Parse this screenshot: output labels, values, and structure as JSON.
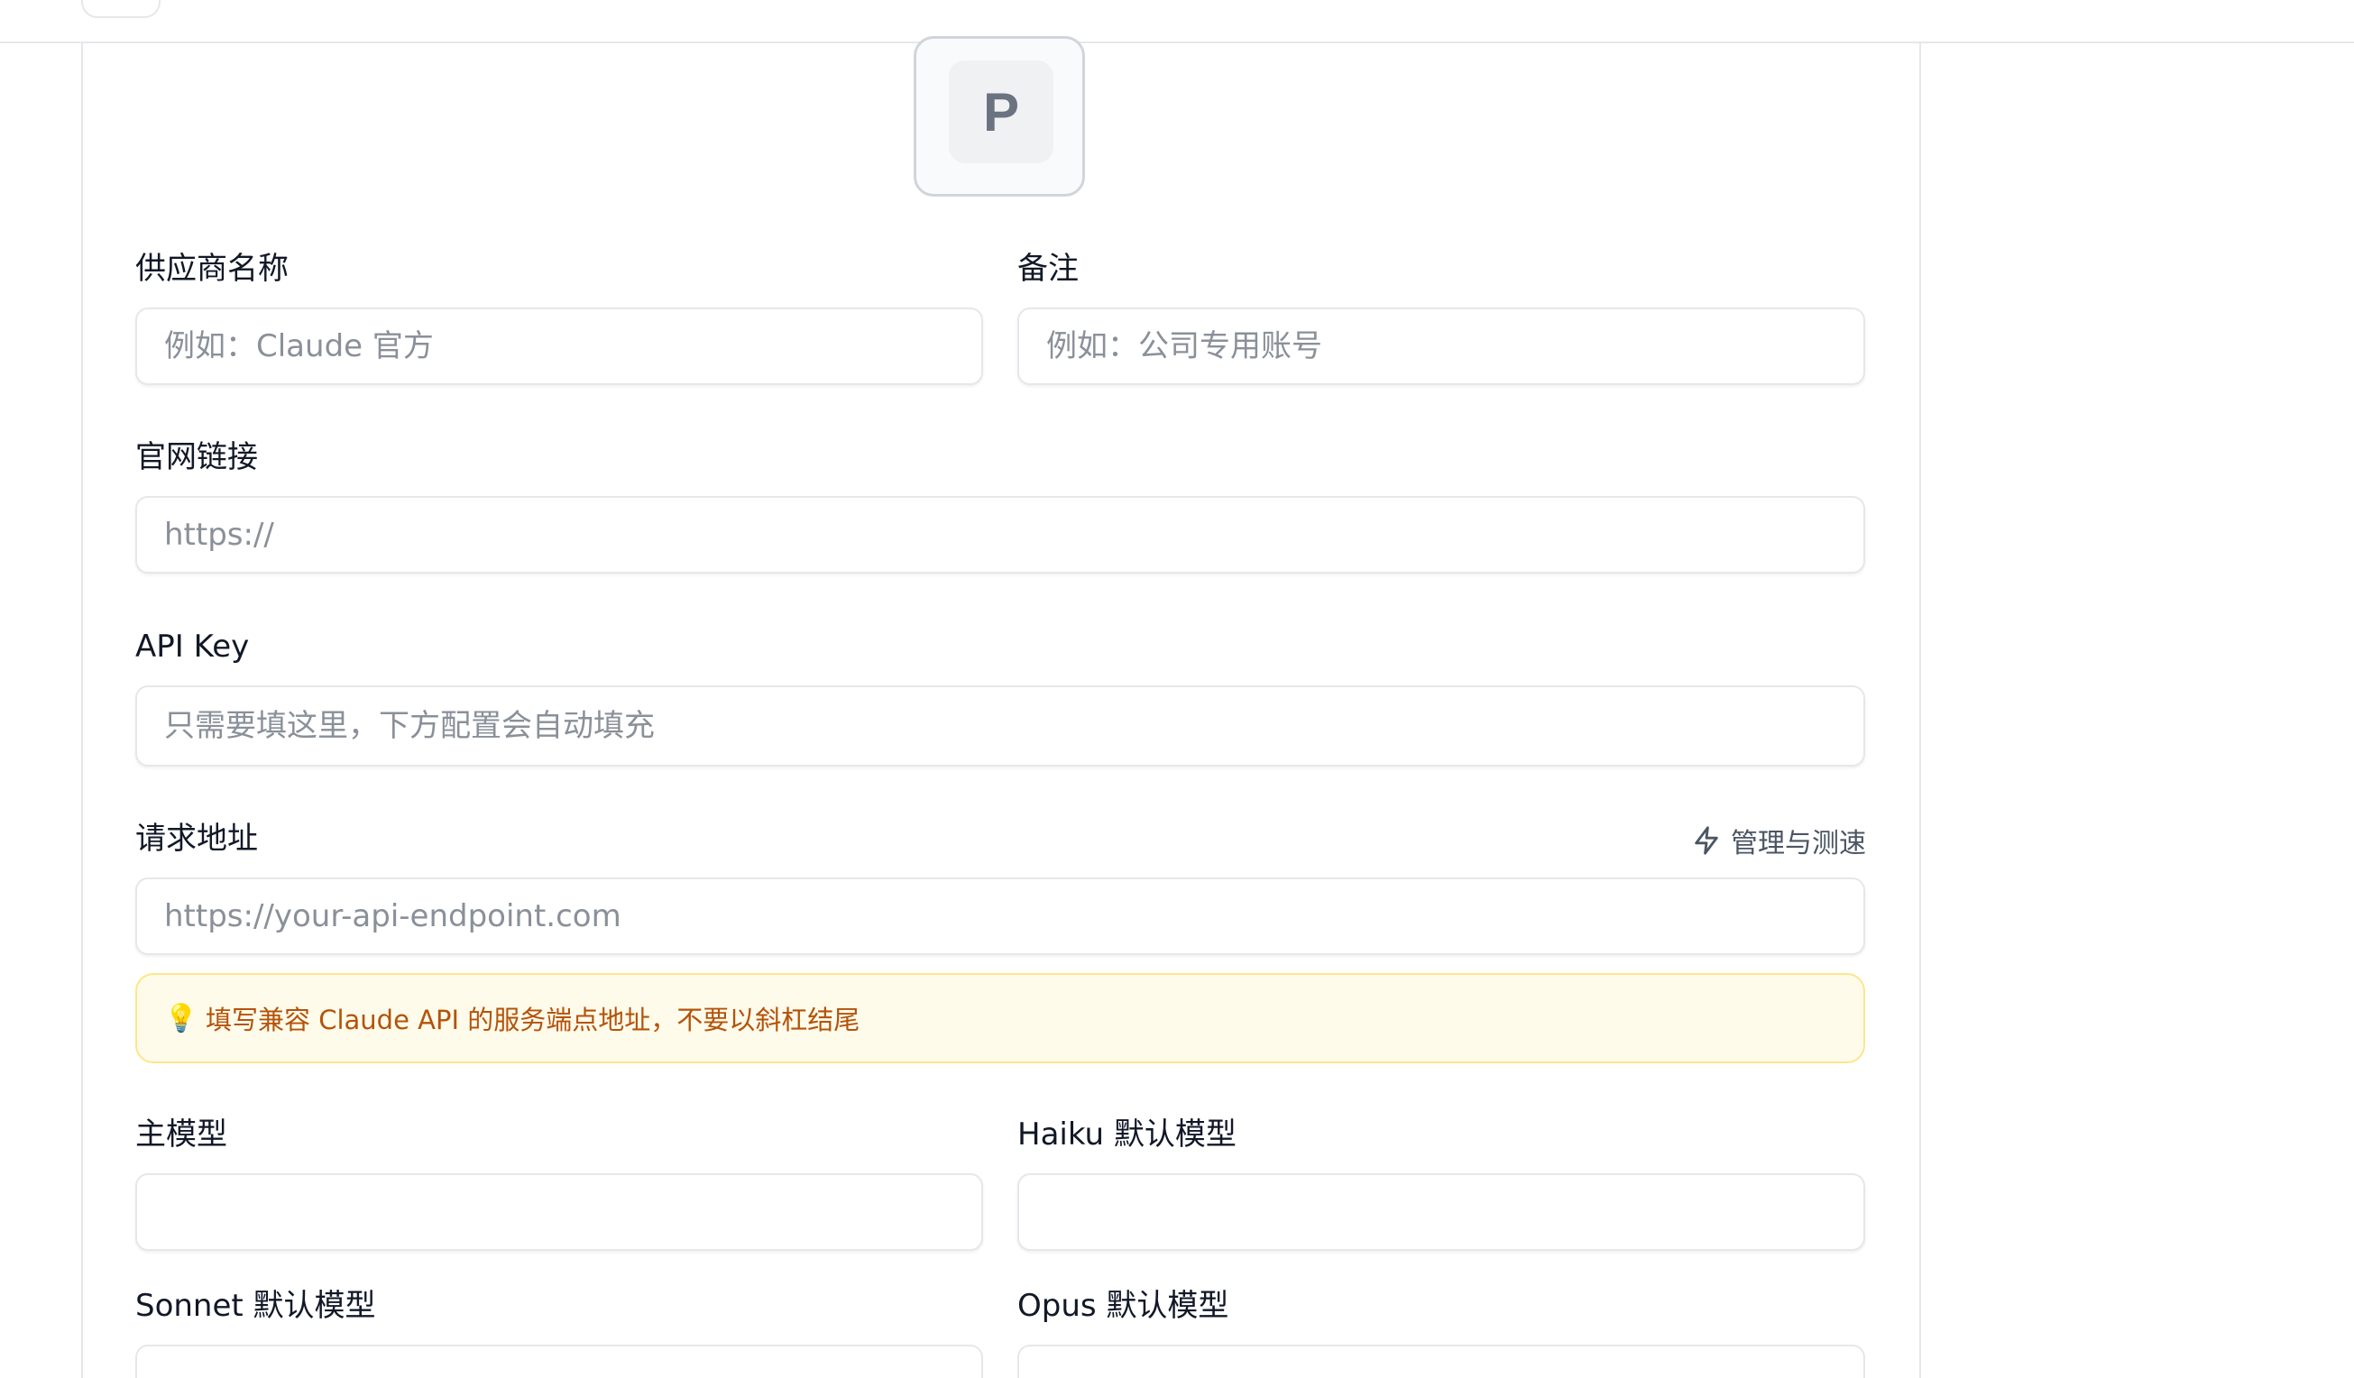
{
  "provider_icon": {
    "letter": "P"
  },
  "form": {
    "name": {
      "label": "供应商名称",
      "placeholder": "例如：Claude 官方",
      "value": ""
    },
    "notes": {
      "label": "备注",
      "placeholder": "例如：公司专用账号",
      "value": ""
    },
    "website": {
      "label": "官网链接",
      "placeholder": "https://",
      "value": ""
    },
    "api_key": {
      "label": "API Key",
      "placeholder": "只需要填这里，下方配置会自动填充",
      "value": ""
    },
    "endpoint": {
      "label": "请求地址",
      "placeholder": "https://your-api-endpoint.com",
      "value": "",
      "manage_link": "管理与测速",
      "tip": "填写兼容 Claude API 的服务端点地址，不要以斜杠结尾"
    },
    "main_model": {
      "label": "主模型",
      "value": ""
    },
    "haiku_model": {
      "label": "Haiku 默认模型",
      "value": ""
    },
    "sonnet_model": {
      "label": "Sonnet 默认模型",
      "value": ""
    },
    "opus_model": {
      "label": "Opus 默认模型",
      "value": ""
    }
  },
  "icons": {
    "manage": "lightning-bolt-icon",
    "tip": "lightbulb-icon"
  },
  "colors": {
    "tip_background": "#fffbeb",
    "tip_border": "#fde68a",
    "tip_text": "#b45309",
    "border": "#e5e7eb"
  }
}
